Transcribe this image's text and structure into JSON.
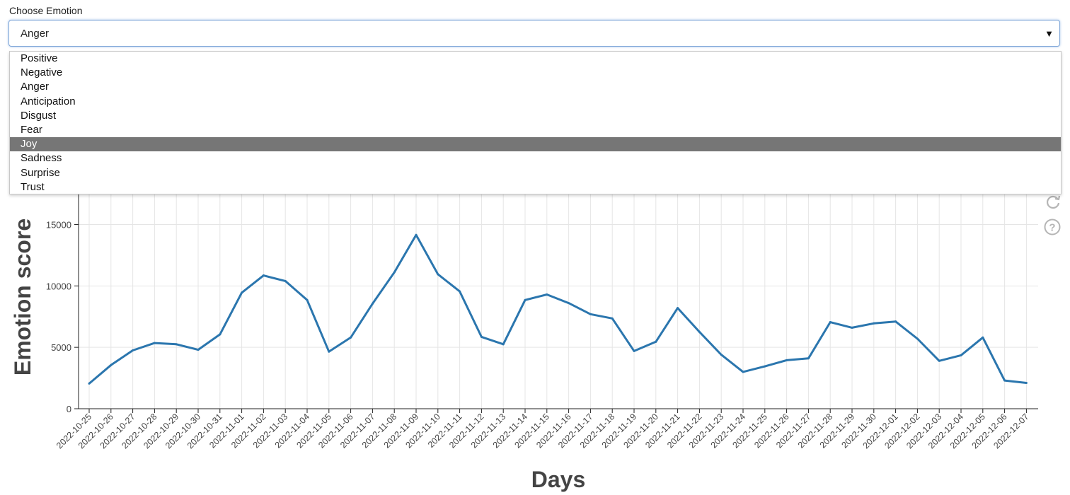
{
  "select": {
    "label": "Choose Emotion",
    "value": "Anger",
    "caret": "▼",
    "options": [
      "Positive",
      "Negative",
      "Anger",
      "Anticipation",
      "Disgust",
      "Fear",
      "Joy",
      "Sadness",
      "Surprise",
      "Trust"
    ],
    "highlighted": "Joy"
  },
  "toolbar": {
    "icons": [
      "reset-icon",
      "help-icon"
    ],
    "help_glyph": "?"
  },
  "colors": {
    "line": "#2b76ae",
    "grid": "#e5e5e5",
    "axis": "#222222",
    "highlight": "#767676"
  },
  "chart_data": {
    "type": "line",
    "xlabel": "Days",
    "ylabel": "Emotion score",
    "ylim": [
      0,
      19000
    ],
    "yticks": [
      0,
      5000,
      10000,
      15000
    ],
    "grid": true,
    "x": [
      "2022-10-25",
      "2022-10-26",
      "2022-10-27",
      "2022-10-28",
      "2022-10-29",
      "2022-10-30",
      "2022-10-31",
      "2022-11-01",
      "2022-11-02",
      "2022-11-03",
      "2022-11-04",
      "2022-11-05",
      "2022-11-06",
      "2022-11-07",
      "2022-11-08",
      "2022-11-09",
      "2022-11-10",
      "2022-11-11",
      "2022-11-12",
      "2022-11-13",
      "2022-11-14",
      "2022-11-15",
      "2022-11-16",
      "2022-11-17",
      "2022-11-18",
      "2022-11-19",
      "2022-11-20",
      "2022-11-21",
      "2022-11-22",
      "2022-11-23",
      "2022-11-24",
      "2022-11-25",
      "2022-11-26",
      "2022-11-27",
      "2022-11-28",
      "2022-11-29",
      "2022-11-30",
      "2022-12-01",
      "2022-12-02",
      "2022-12-03",
      "2022-12-04",
      "2022-12-05",
      "2022-12-06",
      "2022-12-07"
    ],
    "series": [
      {
        "values": [
          2050,
          3550,
          4750,
          5350,
          5250,
          4800,
          6050,
          9450,
          10850,
          10400,
          8850,
          4650,
          5800,
          8550,
          11100,
          14150,
          10950,
          9550,
          5850,
          5250,
          8850,
          9300,
          8600,
          7700,
          7350,
          4700,
          5450,
          8200,
          6250,
          4400,
          3000,
          3450,
          3950,
          4100,
          7050,
          6600,
          6950,
          7100,
          5700,
          3900,
          4350,
          5800,
          2300,
          2100
        ]
      }
    ]
  }
}
